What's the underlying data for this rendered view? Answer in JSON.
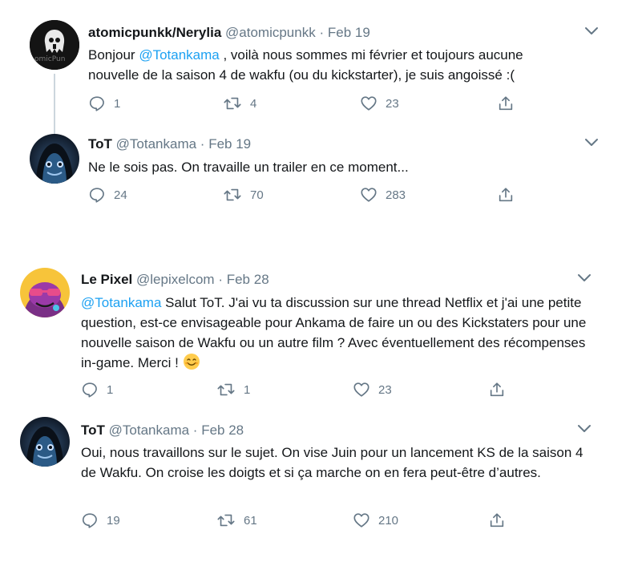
{
  "tweets": [
    {
      "name": "atomicpunkk/Nerylia",
      "handle": "@atomicpunkk",
      "dot": "·",
      "date": "Feb 19",
      "avatar_text": "omicPun",
      "mention": "@Totankama",
      "text": " , voilà nous sommes mi février et toujours aucune nouvelle de la saison 4 de wakfu (ou du kickstarter), je suis angoissé :(",
      "prefix": "Bonjour ",
      "replies": "1",
      "retweets": "4",
      "likes": "23"
    },
    {
      "name": "ToT",
      "handle": "@Totankama",
      "dot": "·",
      "date": "Feb 19",
      "text": "Ne le sois pas. On travaille un trailer en ce moment...",
      "replies": "24",
      "retweets": "70",
      "likes": "283"
    },
    {
      "name": "Le Pixel",
      "handle": "@lepixelcom",
      "dot": "·",
      "date": "Feb 28",
      "mention": "@Totankama",
      "text": " Salut ToT. J'ai vu ta discussion sur une thread Netflix et j'ai une petite question, est-ce envisageable pour Ankama de faire un ou des Kickstaters pour une nouvelle saison de Wakfu ou un autre film ? Avec éventuellement des récompenses in-game. Merci ! ",
      "replies": "1",
      "retweets": "1",
      "likes": "23"
    },
    {
      "name": "ToT",
      "handle": "@Totankama",
      "dot": "·",
      "date": "Feb 28",
      "text": "Oui, nous travaillons sur le sujet. On vise Juin pour un lancement KS de la saison 4 de Wakfu. On croise les doigts et si ça marche on en fera peut-être d’autres.",
      "replies": "19",
      "retweets": "61",
      "likes": "210"
    }
  ],
  "icons": {
    "reply": "reply-icon",
    "retweet": "retweet-icon",
    "like": "like-icon",
    "share": "share-icon",
    "caret": "chevron-down-icon",
    "emoji": "smiling-face-emoji"
  },
  "colors": {
    "text": "#14171a",
    "secondary": "#657786",
    "mention": "#1da1f2",
    "thread_line": "#ccd6dd"
  }
}
